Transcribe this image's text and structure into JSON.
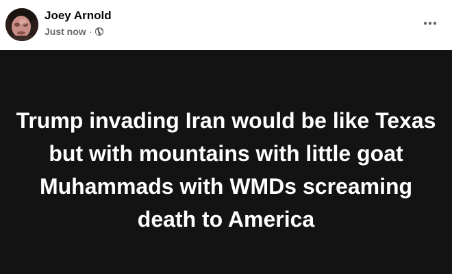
{
  "post": {
    "author": {
      "name": "Joey Arnold",
      "avatar_icon": "profile-photo"
    },
    "meta": {
      "timestamp": "Just now",
      "separator": "·",
      "audience_icon": "globe-icon"
    },
    "menu_icon": "more-options-icon",
    "body": {
      "text": "Trump invading Iran would be like Texas but with mountains with little goat Muhammads with WMDs screaming death to America",
      "background_color": "#131313",
      "text_color": "#ffffff"
    }
  }
}
